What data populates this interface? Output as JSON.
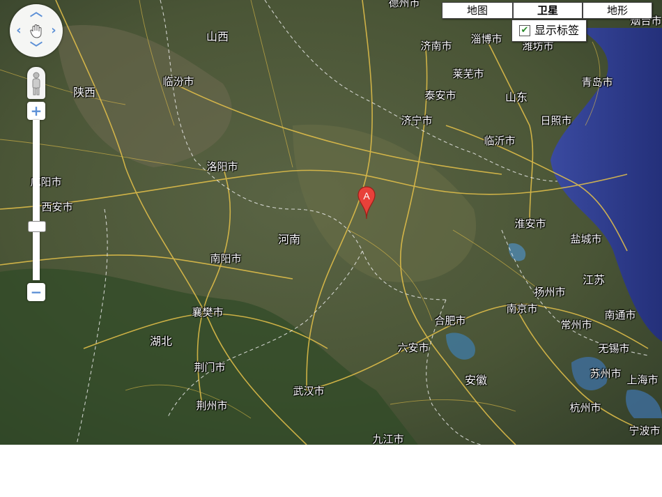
{
  "map_types": [
    {
      "label": "地图",
      "active": false
    },
    {
      "label": "卫星",
      "active": true
    },
    {
      "label": "地形",
      "active": false
    }
  ],
  "show_labels": {
    "label": "显示标签",
    "checked": true
  },
  "marker": {
    "letter": "A",
    "color": "#e8413a"
  },
  "provinces": [
    "山西",
    "陕西",
    "山东",
    "河南",
    "湖北",
    "江苏",
    "安徽"
  ],
  "cities": [
    "济南市",
    "淄博市",
    "潍坊市",
    "青岛市",
    "莱芜市",
    "泰安市",
    "临汾市",
    "济宁市",
    "日照市",
    "临沂市",
    "洛阳市",
    "咸阳市",
    "西安市",
    "淮安市",
    "盐城市",
    "南阳市",
    "扬州市",
    "南京市",
    "南通市",
    "襄樊市",
    "合肥市",
    "常州市",
    "无锡市",
    "六安市",
    "苏州市",
    "上海市",
    "荆门市",
    "武汉市",
    "荆州市",
    "杭州市",
    "九江市",
    "宁波市",
    "德州市",
    "烟台市"
  ],
  "colors": {
    "land": "#4f5a3a",
    "sea": "#2f3f8e",
    "roads": "#e6c24a",
    "borders": "#e8e8e8"
  },
  "icons": {
    "pan": "hand-icon",
    "pegman": "pegman-icon",
    "zoom_in": "plus-icon",
    "zoom_out": "minus-icon"
  }
}
